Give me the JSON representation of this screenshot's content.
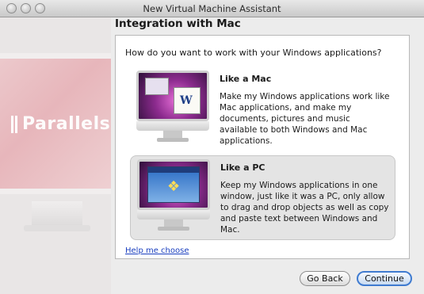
{
  "window": {
    "title": "New Virtual Machine Assistant"
  },
  "sidebar": {
    "brand": "Parallels"
  },
  "page": {
    "heading": "Integration with Mac",
    "question": "How do you want to work with your Windows applications?"
  },
  "options": [
    {
      "title": "Like a Mac",
      "description": "Make my Windows applications work like Mac applications, and make my documents, pictures and music available to both Windows and Mac applications.",
      "selected": false,
      "icon": "imac-coherence-icon"
    },
    {
      "title": "Like a PC",
      "description": "Keep my Windows applications in one window, just like it was a PC, only allow to drag and drop objects as well as copy and paste text between Windows and Mac.",
      "selected": true,
      "icon": "imac-windows-icon"
    }
  ],
  "help": {
    "label": "Help me choose"
  },
  "buttons": {
    "back": "Go Back",
    "continue": "Continue"
  },
  "colors": {
    "link": "#1a3fbf",
    "default_button_border": "#3f7bd0",
    "selected_option_bg": "#e4e4e4"
  }
}
